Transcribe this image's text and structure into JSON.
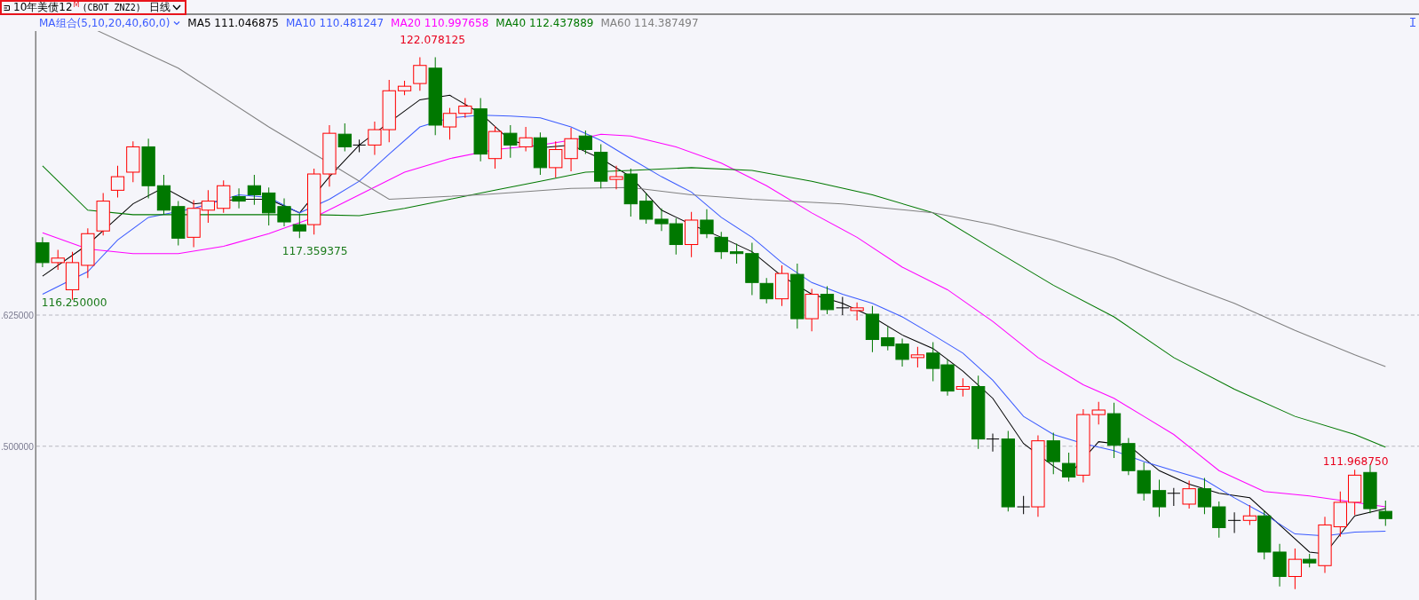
{
  "header": {
    "title": "10年美债12",
    "mark": "M",
    "code": "(CBOT ZNZ2)",
    "period": "日线",
    "highlighted": true
  },
  "legend": {
    "group": "MA组合(5,10,20,40,60,0)",
    "lines": [
      {
        "name": "MA5",
        "value": "111.046875",
        "color": "#000000"
      },
      {
        "name": "MA10",
        "value": "110.481247",
        "color": "#3b5bff"
      },
      {
        "name": "MA20",
        "value": "110.997658",
        "color": "#ff00ff"
      },
      {
        "name": "MA40",
        "value": "112.437889",
        "color": "#007800"
      },
      {
        "name": "MA60",
        "value": "114.387497",
        "color": "#808080"
      }
    ]
  },
  "y_axis": {
    "labels": [
      ".625000",
      ".500000"
    ]
  },
  "annotations": [
    {
      "text": "122.078125",
      "kind": "high"
    },
    {
      "text": "117.359375",
      "kind": "low"
    },
    {
      "text": "116.250000",
      "kind": "low"
    },
    {
      "text": "111.968750",
      "kind": "high"
    }
  ]
}
